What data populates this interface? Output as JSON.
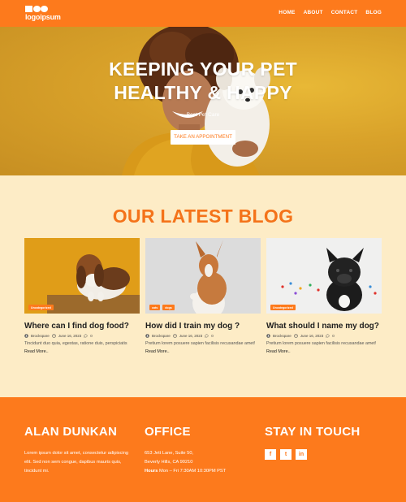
{
  "header": {
    "logo_text": "logoipsum",
    "nav": [
      "HOME",
      "ABOUT",
      "CONTACT",
      "BLOG"
    ]
  },
  "hero": {
    "title_line1": "KEEPING YOUR PET",
    "title_line2": "HEALTHY & HAPPY",
    "subtitle": "Best Pet Care",
    "button": "TAKE AN APPOINTMENT"
  },
  "blog": {
    "heading": "OUR LATEST BLOG",
    "posts": [
      {
        "badges": [
          "Uncategorized"
        ],
        "title": "Where can I find dog food?",
        "author": "Brockspare",
        "date": "June 16, 2023",
        "comments": "0",
        "excerpt": "Tincidunt duo quia, egestas, ratione duis, perspiciatis",
        "more": "Read More.."
      },
      {
        "badges": [
          "cats",
          "dogs"
        ],
        "title": "How did I train my dog ?",
        "author": "Brockspare",
        "date": "June 16, 2023",
        "comments": "0",
        "excerpt": "Pretium lorem posuere sapien facilisis recusandae amet!",
        "more": "Read More.."
      },
      {
        "badges": [
          "Uncategorized"
        ],
        "title": "What should I name my dog?",
        "author": "Brockspare",
        "date": "June 16, 2023",
        "comments": "0",
        "excerpt": "Pretium lorem posuere sapien facilisis recusandae amet!",
        "more": "Read More.."
      }
    ]
  },
  "footer": {
    "about": {
      "heading": "ALAN DUNKAN",
      "text_line1": "Lorem ipsum dolor sit amet, consectetur adipiscing",
      "text_line2": "elit. Sed non sem congue, dapibus mauris quis,",
      "text_line3": "tincidunt mi."
    },
    "office": {
      "heading": "OFFICE",
      "address1": "653 Jett Lane, Suite 50,",
      "address2": "Beverly Hills, CA 90210",
      "hours_label": "Hours",
      "hours_value": " Mon – Fri 7:30AM 10:30PM PST"
    },
    "contact": {
      "heading": "STAY IN TOUCH",
      "socials": [
        "f",
        "t",
        "in"
      ]
    }
  },
  "colors": {
    "brand_orange": "#fd7a1c",
    "page_cream": "#fdecc6",
    "heading_orange": "#f4731a"
  }
}
